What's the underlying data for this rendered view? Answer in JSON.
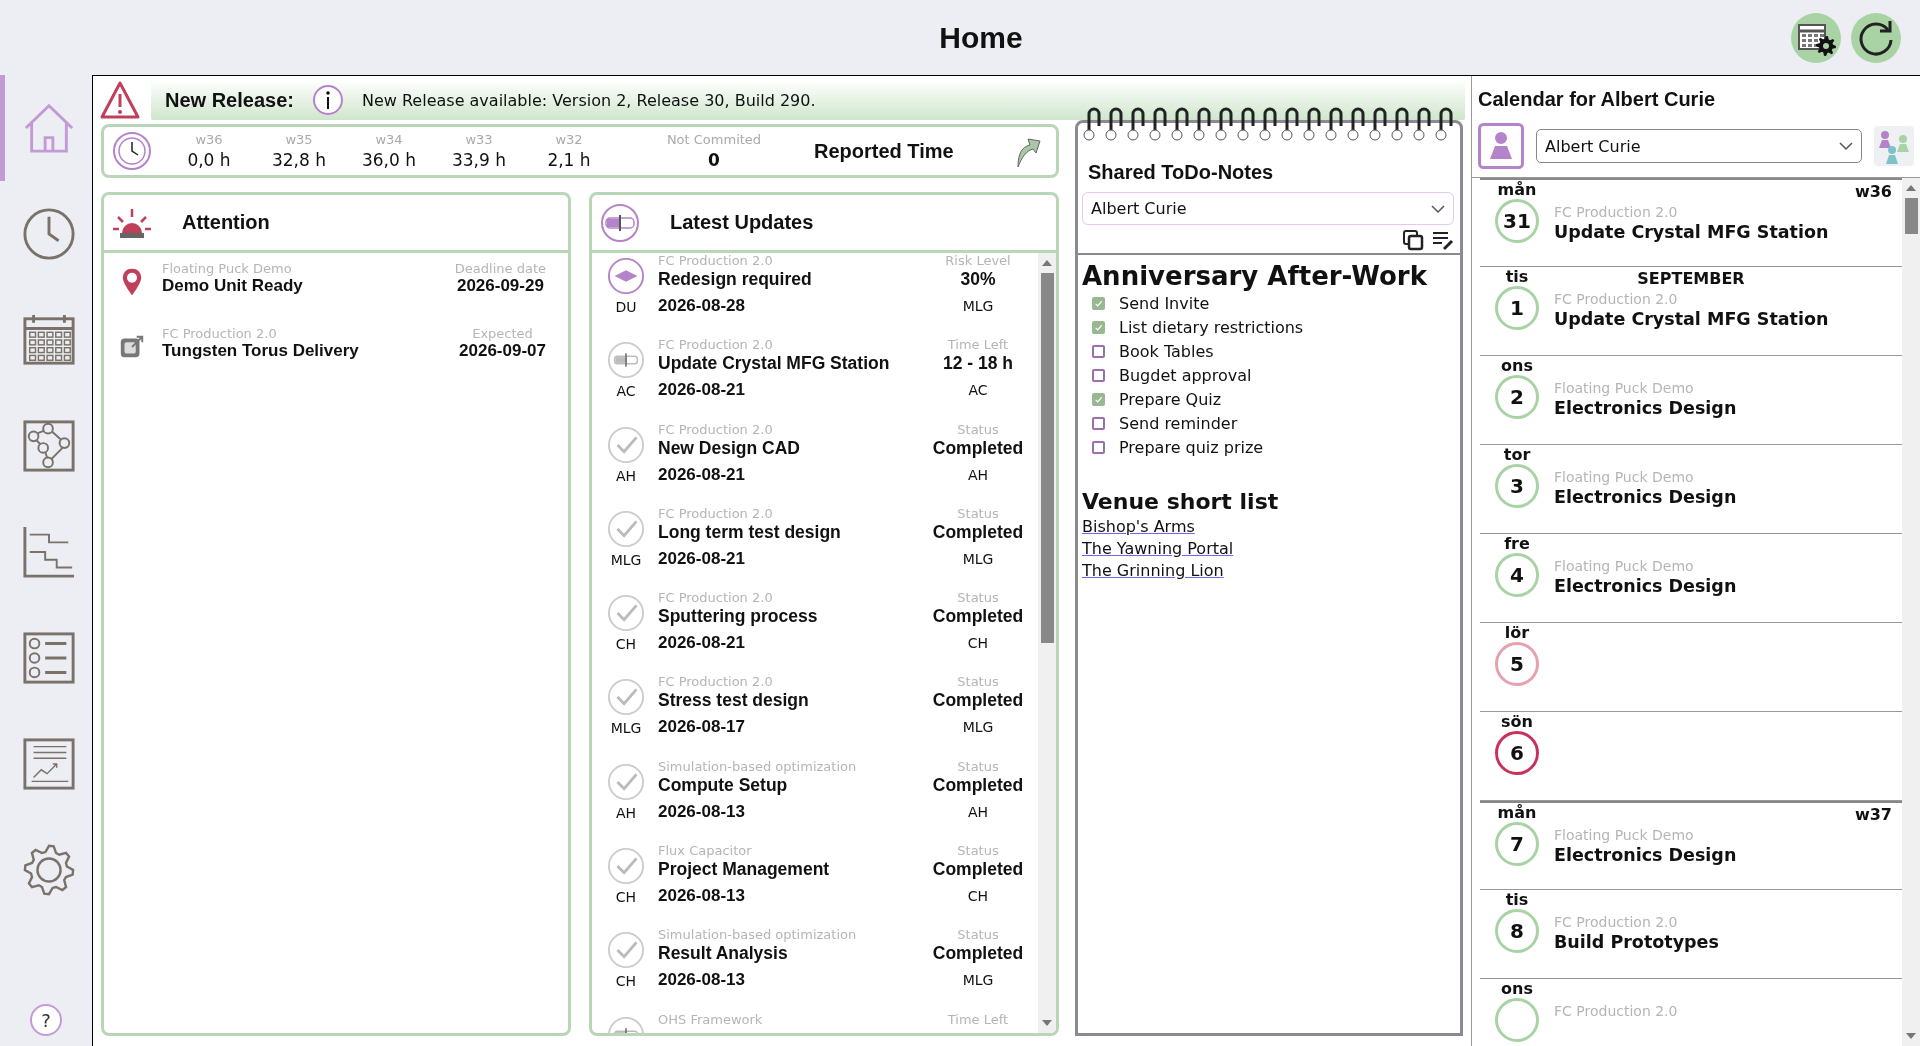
{
  "header": {
    "title": "Home"
  },
  "sidebar": {
    "items": [
      {
        "kind": "home",
        "selected": true
      },
      {
        "kind": "clock",
        "selected": false
      },
      {
        "kind": "calendar",
        "selected": false
      },
      {
        "kind": "network",
        "selected": false
      },
      {
        "kind": "steps",
        "selected": false
      },
      {
        "kind": "list",
        "selected": false
      },
      {
        "kind": "report",
        "selected": false
      },
      {
        "kind": "settings",
        "selected": false
      }
    ],
    "help": "?"
  },
  "release": {
    "label": "New Release:",
    "message": "New Release available: Version 2, Release 30, Build 290."
  },
  "reported_time": {
    "title": "Reported Time",
    "weeks": [
      {
        "label": "w36",
        "value": "0,0 h"
      },
      {
        "label": "w35",
        "value": "32,8 h"
      },
      {
        "label": "w34",
        "value": "36,0 h"
      },
      {
        "label": "w33",
        "value": "33,9 h"
      },
      {
        "label": "w32",
        "value": "2,1 h"
      }
    ],
    "uncommitted": {
      "label": "Not Commited",
      "value": "0"
    }
  },
  "attention": {
    "title": "Attention",
    "items": [
      {
        "kind": "pin",
        "category": "Floating Puck Demo",
        "title": "Demo Unit Ready",
        "label": "Deadline date",
        "date": "2026-09-29"
      },
      {
        "kind": "delivery",
        "category": "FC Production 2.0",
        "title": "Tungsten Torus Delivery",
        "label": "Expected",
        "date": "2026-09-07"
      }
    ]
  },
  "latest_updates": {
    "title": "Latest Updates",
    "items": [
      {
        "kind": "risk",
        "initials": "DU",
        "category": "FC Production 2.0",
        "title": "Redesign required",
        "date": "2026-08-28",
        "label": "Risk Level",
        "value": "30%",
        "owner": "MLG"
      },
      {
        "kind": "time",
        "initials": "AC",
        "category": "FC Production 2.0",
        "title": "Update Crystal MFG Station",
        "date": "2026-08-21",
        "label": "Time Left",
        "value": "12 - 18 h",
        "owner": "AC"
      },
      {
        "kind": "done",
        "initials": "AH",
        "category": "FC Production 2.0",
        "title": "New Design CAD",
        "date": "2026-08-21",
        "label": "Status",
        "value": "Completed",
        "owner": "AH"
      },
      {
        "kind": "done",
        "initials": "MLG",
        "category": "FC Production 2.0",
        "title": "Long term test design",
        "date": "2026-08-21",
        "label": "Status",
        "value": "Completed",
        "owner": "MLG"
      },
      {
        "kind": "done",
        "initials": "CH",
        "category": "FC Production 2.0",
        "title": "Sputtering process",
        "date": "2026-08-21",
        "label": "Status",
        "value": "Completed",
        "owner": "CH"
      },
      {
        "kind": "done",
        "initials": "MLG",
        "category": "FC Production 2.0",
        "title": "Stress test design",
        "date": "2026-08-17",
        "label": "Status",
        "value": "Completed",
        "owner": "MLG"
      },
      {
        "kind": "done",
        "initials": "AH",
        "category": "Simulation-based optimization",
        "title": "Compute Setup",
        "date": "2026-08-13",
        "label": "Status",
        "value": "Completed",
        "owner": "AH"
      },
      {
        "kind": "done",
        "initials": "CH",
        "category": "Flux Capacitor",
        "title": "Project Management",
        "date": "2026-08-13",
        "label": "Status",
        "value": "Completed",
        "owner": "CH"
      },
      {
        "kind": "done",
        "initials": "CH",
        "category": "Simulation-based optimization",
        "title": "Result Analysis",
        "date": "2026-08-13",
        "label": "Status",
        "value": "Completed",
        "owner": "MLG"
      },
      {
        "kind": "time",
        "category": "OHS Framework",
        "label": "Time Left"
      }
    ]
  },
  "notes": {
    "title": "Shared ToDo-Notes",
    "user": "Albert Curie",
    "heading": "Anniversary After-Work",
    "todos": [
      {
        "text": "Send Invite",
        "checked": true
      },
      {
        "text": "List dietary restrictions",
        "checked": true
      },
      {
        "text": "Book Tables",
        "checked": false
      },
      {
        "text": "Bugdet approval",
        "checked": false
      },
      {
        "text": "Prepare Quiz",
        "checked": true
      },
      {
        "text": "Send reminder",
        "checked": false
      },
      {
        "text": "Prepare quiz prize",
        "checked": false
      }
    ],
    "subheading": "Venue short list",
    "links": [
      "Bishop's Arms",
      "The Yawning Portal",
      "The Grinning Lion"
    ]
  },
  "calendar": {
    "title": "Calendar for Albert Curie",
    "user": "Albert Curie",
    "days": [
      {
        "weekday": "mån",
        "day": "31",
        "color": "#a9d3a5",
        "week": "w36",
        "category": "FC Production 2.0",
        "title": "Update Crystal MFG Station"
      },
      {
        "weekday": "tis",
        "day": "1",
        "color": "#a9d3a5",
        "month": "SEPTEMBER",
        "category": "FC Production 2.0",
        "title": "Update Crystal MFG Station"
      },
      {
        "weekday": "ons",
        "day": "2",
        "color": "#a9d3a5",
        "category": "Floating Puck Demo",
        "title": "Electronics Design"
      },
      {
        "weekday": "tor",
        "day": "3",
        "color": "#a9d3a5",
        "category": "Floating Puck Demo",
        "title": "Electronics Design"
      },
      {
        "weekday": "fre",
        "day": "4",
        "color": "#a9d3a5",
        "category": "Floating Puck Demo",
        "title": "Electronics Design"
      },
      {
        "weekday": "lör",
        "day": "5",
        "color": "#e4a1b0"
      },
      {
        "weekday": "sön",
        "day": "6",
        "color": "#c8325a"
      },
      {
        "weekday": "mån",
        "day": "7",
        "color": "#a9d3a5",
        "week": "w37",
        "category": "Floating Puck Demo",
        "title": "Electronics Design"
      },
      {
        "weekday": "tis",
        "day": "8",
        "color": "#a9d3a5",
        "category": "FC Production 2.0",
        "title": "Build Prototypes"
      },
      {
        "weekday": "ons",
        "color": "#a9d3a5",
        "category": "FC Production 2.0"
      }
    ]
  }
}
